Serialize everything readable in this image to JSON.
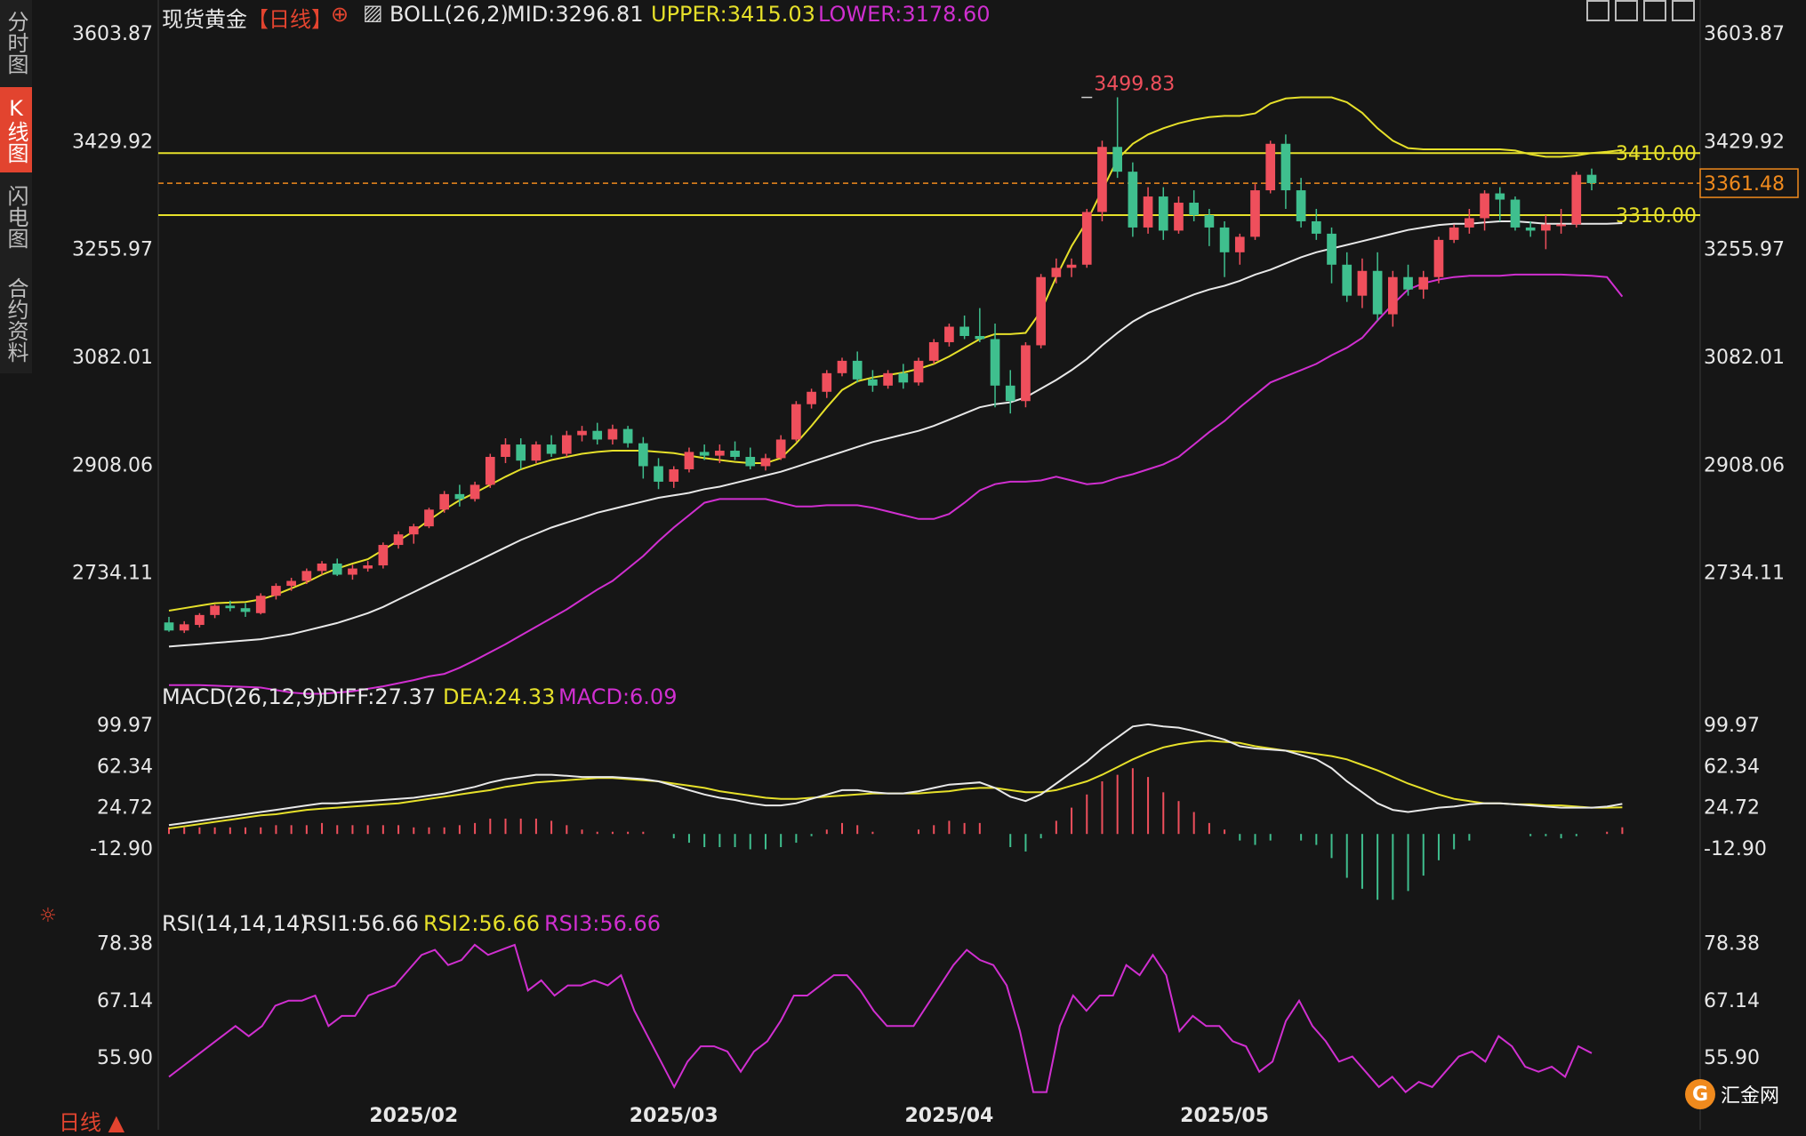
{
  "sidebar": {
    "tabs": [
      {
        "label": "分时图",
        "active": false
      },
      {
        "label": "K线图",
        "active": true
      },
      {
        "label": "闪电图",
        "active": false
      },
      {
        "label": "合约资料",
        "active": false
      }
    ]
  },
  "header": {
    "instrument": "现货黄金",
    "period_tag": "【日线】",
    "boll": "BOLL(26,2)",
    "mid": "MID:3296.81",
    "upper": "UPPER:3415.03",
    "lower": "LOWER:3178.60"
  },
  "macd_header": {
    "name": "MACD(26,12,9)",
    "diff": "DIFF:27.37",
    "dea": "DEA:24.33",
    "macd": "MACD:6.09"
  },
  "rsi_header": {
    "name": "RSI(14,14,14)",
    "rsi1": "RSI1:56.66",
    "rsi2": "RSI2:56.66",
    "rsi3": "RSI3:56.66"
  },
  "footer": {
    "period": "日线 ▲",
    "logo_text": "汇金网",
    "logo_glyph": "G"
  },
  "colors": {
    "up": "#ef4f5c",
    "down": "#3fbf8e",
    "upper": "#e6e02a",
    "mid": "#e8e8e8",
    "lower": "#d02fd0",
    "dea": "#e6e02a",
    "rsi": "#d02fd0"
  },
  "chart_data": [
    {
      "type": "candlestick",
      "title": "现货黄金 日线",
      "price_axis_ticks": [
        3603.87,
        3429.92,
        3255.97,
        3082.01,
        2908.06,
        2734.11
      ],
      "ylim": [
        2596,
        3603.87
      ],
      "x_tick_labels": [
        {
          "label": "2025/02",
          "index": 16
        },
        {
          "label": "2025/03",
          "index": 33
        },
        {
          "label": "2025/04",
          "index": 51
        },
        {
          "label": "2025/05",
          "index": 69
        }
      ],
      "annotations": [
        {
          "text": "3499.83",
          "index": 60,
          "value": 3499.83
        }
      ],
      "horizontal_lines": [
        {
          "label": "3410.00",
          "value": 3410.0,
          "style": "solid"
        },
        {
          "label": "3310.00",
          "value": 3310.0,
          "style": "solid"
        },
        {
          "label": "3361.48",
          "value": 3361.48,
          "style": "dashed"
        }
      ],
      "ohlc": [
        [
          2653,
          2662,
          2638,
          2640
        ],
        [
          2640,
          2655,
          2636,
          2650
        ],
        [
          2649,
          2668,
          2645,
          2665
        ],
        [
          2665,
          2682,
          2660,
          2680
        ],
        [
          2680,
          2688,
          2671,
          2676
        ],
        [
          2676,
          2684,
          2662,
          2670
        ],
        [
          2668,
          2700,
          2666,
          2696
        ],
        [
          2696,
          2716,
          2690,
          2712
        ],
        [
          2712,
          2725,
          2704,
          2720
        ],
        [
          2720,
          2740,
          2715,
          2736
        ],
        [
          2736,
          2752,
          2730,
          2748
        ],
        [
          2748,
          2756,
          2728,
          2730
        ],
        [
          2730,
          2746,
          2722,
          2740
        ],
        [
          2740,
          2752,
          2735,
          2745
        ],
        [
          2745,
          2782,
          2740,
          2778
        ],
        [
          2778,
          2800,
          2772,
          2795
        ],
        [
          2795,
          2812,
          2780,
          2808
        ],
        [
          2808,
          2838,
          2805,
          2835
        ],
        [
          2835,
          2865,
          2830,
          2860
        ],
        [
          2860,
          2875,
          2840,
          2852
        ],
        [
          2852,
          2880,
          2848,
          2875
        ],
        [
          2875,
          2925,
          2870,
          2920
        ],
        [
          2920,
          2950,
          2910,
          2940
        ],
        [
          2940,
          2950,
          2900,
          2914
        ],
        [
          2914,
          2945,
          2910,
          2940
        ],
        [
          2940,
          2955,
          2920,
          2925
        ],
        [
          2925,
          2962,
          2920,
          2955
        ],
        [
          2955,
          2970,
          2945,
          2962
        ],
        [
          2962,
          2975,
          2940,
          2948
        ],
        [
          2948,
          2972,
          2940,
          2965
        ],
        [
          2965,
          2970,
          2935,
          2942
        ],
        [
          2942,
          2952,
          2885,
          2905
        ],
        [
          2905,
          2918,
          2868,
          2880
        ],
        [
          2880,
          2905,
          2870,
          2900
        ],
        [
          2900,
          2935,
          2895,
          2928
        ],
        [
          2928,
          2940,
          2915,
          2922
        ],
        [
          2922,
          2940,
          2910,
          2930
        ],
        [
          2930,
          2945,
          2915,
          2920
        ],
        [
          2920,
          2935,
          2900,
          2905
        ],
        [
          2905,
          2925,
          2898,
          2918
        ],
        [
          2918,
          2955,
          2915,
          2948
        ],
        [
          2948,
          3010,
          2945,
          3005
        ],
        [
          3005,
          3030,
          2998,
          3025
        ],
        [
          3025,
          3060,
          3015,
          3055
        ],
        [
          3055,
          3080,
          3050,
          3075
        ],
        [
          3075,
          3090,
          3040,
          3045
        ],
        [
          3045,
          3060,
          3025,
          3035
        ],
        [
          3035,
          3060,
          3030,
          3055
        ],
        [
          3055,
          3070,
          3030,
          3040
        ],
        [
          3040,
          3080,
          3035,
          3075
        ],
        [
          3075,
          3110,
          3070,
          3105
        ],
        [
          3105,
          3135,
          3098,
          3130
        ],
        [
          3130,
          3148,
          3110,
          3115
        ],
        [
          3115,
          3160,
          3105,
          3110
        ],
        [
          3110,
          3135,
          3000,
          3035
        ],
        [
          3035,
          3060,
          2990,
          3010
        ],
        [
          3010,
          3105,
          3000,
          3100
        ],
        [
          3100,
          3215,
          3095,
          3210
        ],
        [
          3210,
          3240,
          3200,
          3225
        ],
        [
          3225,
          3240,
          3210,
          3230
        ],
        [
          3230,
          3320,
          3225,
          3315
        ],
        [
          3315,
          3430,
          3300,
          3420
        ],
        [
          3420,
          3500,
          3370,
          3380
        ],
        [
          3380,
          3395,
          3275,
          3290
        ],
        [
          3290,
          3355,
          3280,
          3340
        ],
        [
          3340,
          3355,
          3270,
          3285
        ],
        [
          3285,
          3340,
          3280,
          3330
        ],
        [
          3330,
          3350,
          3300,
          3310
        ],
        [
          3310,
          3320,
          3260,
          3290
        ],
        [
          3290,
          3300,
          3210,
          3250
        ],
        [
          3250,
          3280,
          3230,
          3275
        ],
        [
          3275,
          3360,
          3270,
          3350
        ],
        [
          3350,
          3430,
          3345,
          3425
        ],
        [
          3425,
          3440,
          3320,
          3350
        ],
        [
          3350,
          3370,
          3290,
          3300
        ],
        [
          3300,
          3320,
          3270,
          3280
        ],
        [
          3280,
          3290,
          3200,
          3230
        ],
        [
          3230,
          3250,
          3170,
          3180
        ],
        [
          3180,
          3240,
          3160,
          3220
        ],
        [
          3220,
          3250,
          3140,
          3150
        ],
        [
          3150,
          3220,
          3130,
          3210
        ],
        [
          3210,
          3230,
          3180,
          3190
        ],
        [
          3190,
          3220,
          3175,
          3210
        ],
        [
          3210,
          3275,
          3200,
          3270
        ],
        [
          3270,
          3295,
          3265,
          3290
        ],
        [
          3290,
          3320,
          3280,
          3305
        ],
        [
          3305,
          3350,
          3285,
          3345
        ],
        [
          3345,
          3355,
          3300,
          3335
        ],
        [
          3335,
          3340,
          3285,
          3290
        ],
        [
          3290,
          3300,
          3275,
          3285
        ],
        [
          3285,
          3310,
          3255,
          3295
        ],
        [
          3295,
          3320,
          3280,
          3295
        ],
        [
          3295,
          3380,
          3290,
          3375
        ],
        [
          3375,
          3385,
          3350,
          3361.48
        ]
      ],
      "boll_upper": [
        2672,
        2676,
        2680,
        2684,
        2685,
        2686,
        2690,
        2698,
        2708,
        2718,
        2730,
        2740,
        2748,
        2755,
        2770,
        2785,
        2800,
        2818,
        2835,
        2850,
        2862,
        2875,
        2888,
        2900,
        2908,
        2915,
        2920,
        2925,
        2928,
        2930,
        2930,
        2930,
        2928,
        2926,
        2922,
        2918,
        2915,
        2912,
        2910,
        2910,
        2918,
        2942,
        2970,
        3000,
        3028,
        3042,
        3048,
        3052,
        3056,
        3062,
        3070,
        3082,
        3096,
        3110,
        3118,
        3118,
        3120,
        3155,
        3210,
        3260,
        3300,
        3350,
        3400,
        3425,
        3440,
        3450,
        3458,
        3464,
        3468,
        3470,
        3470,
        3474,
        3490,
        3498,
        3500,
        3500,
        3500,
        3492,
        3475,
        3450,
        3430,
        3418,
        3416,
        3416,
        3416,
        3416,
        3416,
        3416,
        3414,
        3408,
        3404,
        3404,
        3406,
        3410,
        3412,
        3415
      ],
      "boll_mid": [
        2614,
        2616,
        2618,
        2620,
        2622,
        2624,
        2626,
        2630,
        2634,
        2640,
        2646,
        2652,
        2660,
        2668,
        2678,
        2690,
        2702,
        2714,
        2726,
        2738,
        2750,
        2762,
        2774,
        2786,
        2796,
        2806,
        2814,
        2822,
        2830,
        2836,
        2842,
        2848,
        2854,
        2858,
        2862,
        2868,
        2872,
        2878,
        2884,
        2890,
        2896,
        2904,
        2912,
        2920,
        2928,
        2936,
        2944,
        2950,
        2956,
        2962,
        2970,
        2980,
        2990,
        3000,
        3005,
        3008,
        3016,
        3030,
        3044,
        3060,
        3078,
        3100,
        3120,
        3138,
        3152,
        3162,
        3172,
        3182,
        3190,
        3196,
        3204,
        3214,
        3222,
        3232,
        3242,
        3250,
        3256,
        3262,
        3268,
        3274,
        3280,
        3286,
        3290,
        3294,
        3296,
        3296,
        3298,
        3300,
        3300,
        3298,
        3296,
        3296,
        3296,
        3296,
        3296,
        3297
      ],
      "boll_lower": [
        2552,
        2552,
        2552,
        2551,
        2550,
        2549,
        2548,
        2544,
        2540,
        2538,
        2538,
        2540,
        2542,
        2546,
        2550,
        2555,
        2560,
        2566,
        2570,
        2580,
        2592,
        2605,
        2618,
        2632,
        2646,
        2660,
        2674,
        2690,
        2706,
        2720,
        2740,
        2760,
        2784,
        2806,
        2826,
        2846,
        2852,
        2852,
        2852,
        2852,
        2846,
        2840,
        2840,
        2842,
        2842,
        2842,
        2838,
        2832,
        2826,
        2820,
        2820,
        2828,
        2846,
        2866,
        2876,
        2880,
        2880,
        2882,
        2888,
        2882,
        2876,
        2878,
        2886,
        2892,
        2900,
        2908,
        2920,
        2940,
        2960,
        2978,
        3000,
        3020,
        3040,
        3050,
        3060,
        3070,
        3084,
        3096,
        3112,
        3140,
        3166,
        3190,
        3200,
        3206,
        3210,
        3212,
        3212,
        3212,
        3214,
        3214,
        3214,
        3214,
        3213,
        3212,
        3210,
        3178.6
      ]
    },
    {
      "type": "line+bar",
      "title": "MACD(26,12,9)",
      "y_axis_ticks": [
        99.97,
        62.34,
        24.72,
        -12.9
      ],
      "ylim": [
        -42,
        108
      ],
      "diff": [
        8,
        10,
        12,
        14,
        16,
        18,
        20,
        22,
        24,
        26,
        28,
        28,
        29,
        30,
        31,
        32,
        33,
        35,
        37,
        40,
        43,
        47,
        50,
        52,
        54,
        54,
        53,
        52,
        52,
        52,
        51,
        50,
        48,
        44,
        40,
        36,
        33,
        31,
        28,
        26,
        26,
        28,
        32,
        36,
        40,
        40,
        38,
        37,
        37,
        39,
        42,
        45,
        46,
        47,
        42,
        34,
        30,
        36,
        46,
        56,
        66,
        78,
        88,
        98,
        100,
        98,
        97,
        94,
        90,
        86,
        80,
        78,
        77,
        76,
        72,
        68,
        60,
        48,
        38,
        28,
        22,
        20,
        22,
        24,
        25,
        27,
        28,
        28,
        27,
        26,
        25,
        24,
        24,
        24,
        25,
        27.37
      ],
      "dea": [
        5,
        7,
        9,
        11,
        13,
        15,
        17,
        18,
        20,
        22,
        23,
        24,
        25,
        26,
        27,
        28,
        30,
        32,
        34,
        36,
        38,
        40,
        43,
        45,
        47,
        48,
        49,
        50,
        51,
        51,
        50,
        49,
        48,
        46,
        44,
        42,
        39,
        37,
        35,
        33,
        32,
        32,
        33,
        34,
        35,
        36,
        37,
        37,
        37,
        37,
        38,
        39,
        41,
        42,
        42,
        40,
        38,
        38,
        40,
        44,
        48,
        54,
        61,
        68,
        74,
        79,
        82,
        84,
        85,
        84,
        83,
        80,
        78,
        76,
        75,
        73,
        71,
        68,
        63,
        58,
        52,
        46,
        41,
        36,
        32,
        30,
        28,
        28,
        27,
        27,
        26,
        26,
        25,
        24,
        24,
        24.33
      ],
      "macd_hist": [
        6,
        6,
        6,
        6,
        6,
        6,
        6,
        8,
        8,
        8,
        10,
        8,
        8,
        8,
        8,
        8,
        6,
        6,
        6,
        8,
        10,
        14,
        14,
        14,
        14,
        12,
        8,
        4,
        2,
        2,
        2,
        2,
        0,
        -4,
        -8,
        -12,
        -12,
        -12,
        -14,
        -14,
        -12,
        -8,
        -2,
        4,
        10,
        8,
        2,
        0,
        0,
        4,
        8,
        12,
        10,
        10,
        0,
        -12,
        -16,
        -4,
        12,
        24,
        36,
        48,
        54,
        60,
        52,
        38,
        30,
        20,
        10,
        4,
        -6,
        -10,
        -6,
        0,
        -6,
        -10,
        -22,
        -40,
        -50,
        -60,
        -60,
        -52,
        -38,
        -24,
        -14,
        -6,
        0,
        0,
        0,
        -2,
        -2,
        -4,
        -2,
        0,
        2,
        6.09
      ]
    },
    {
      "type": "line",
      "title": "RSI(14,14,14)",
      "y_axis_ticks": [
        78.38,
        67.14,
        55.9
      ],
      "ylim": [
        47,
        82
      ],
      "rsi": [
        52,
        54,
        56,
        58,
        60,
        62,
        60,
        62,
        66,
        67,
        67,
        68,
        62,
        64,
        64,
        68,
        69,
        70,
        73,
        76,
        77,
        74,
        75,
        78,
        76,
        77,
        78,
        69,
        71,
        68,
        70,
        70,
        71,
        70,
        72,
        65,
        60,
        55,
        50,
        55,
        58,
        58,
        57,
        53,
        57,
        59,
        63,
        68,
        68,
        70,
        72,
        72,
        69,
        65,
        62,
        62,
        62,
        66,
        70,
        74,
        77,
        75,
        74,
        70,
        61,
        49,
        49,
        62,
        68,
        65,
        68,
        68,
        74,
        72,
        76,
        72,
        61,
        64,
        62,
        62,
        59,
        58,
        53,
        55,
        63,
        67,
        62,
        59,
        55,
        56,
        53,
        50,
        52,
        49,
        51,
        50,
        53,
        56,
        57,
        55,
        60,
        58,
        54,
        53,
        54,
        52,
        58,
        56.66
      ]
    }
  ]
}
